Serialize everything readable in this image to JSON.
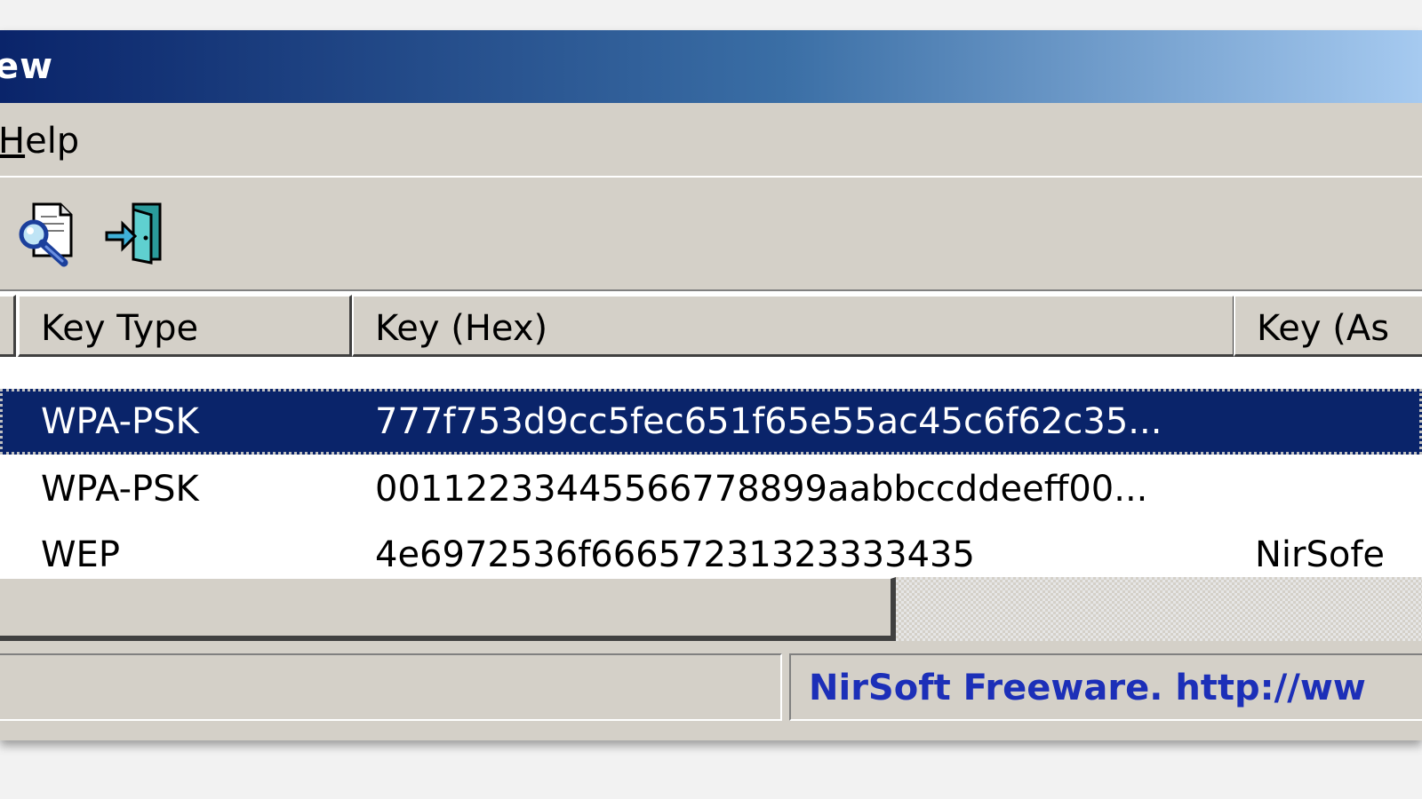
{
  "window": {
    "title": "ew"
  },
  "menu": {
    "help_accel": "H",
    "help_rest": "elp"
  },
  "toolbar": {
    "buttons": [
      {
        "icon": "magnifier-document-icon"
      },
      {
        "icon": "exit-door-icon"
      }
    ]
  },
  "table": {
    "columns": [
      "Key Type",
      "Key (Hex)",
      "Key (As"
    ],
    "rows": [
      {
        "key_type": "WPA-PSK",
        "key_hex": "777f753d9cc5fec651f65e55ac45c6f62c35...",
        "key_ascii": "",
        "selected": true
      },
      {
        "key_type": "WPA-PSK",
        "key_hex": "00112233445566778899aabbccddeeff00...",
        "key_ascii": "",
        "selected": false
      },
      {
        "key_type": "WEP",
        "key_hex": "4e6972536f66657231323333435",
        "key_ascii": "NirSofe",
        "selected": false
      }
    ]
  },
  "status": {
    "link_text": "NirSoft Freeware.  http://ww"
  },
  "colors": {
    "selection": "#0a246a",
    "link": "#1c2fb8",
    "face": "#d4d0c8"
  }
}
